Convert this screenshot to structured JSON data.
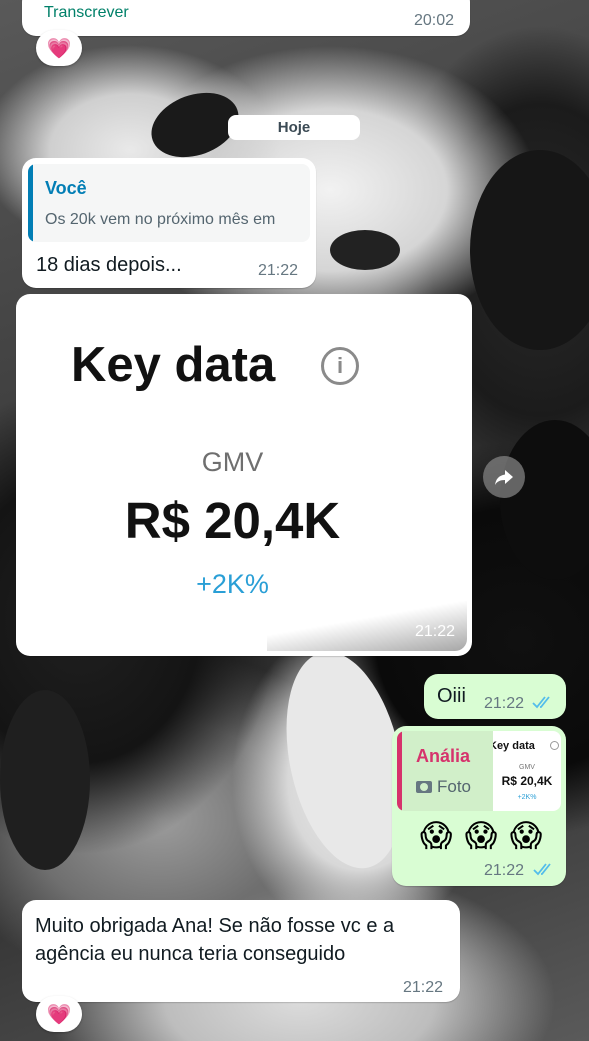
{
  "msg1": {
    "label": "Transcrever",
    "time": "20:02",
    "reaction": "💗"
  },
  "day_chip": "Hoje",
  "msg2": {
    "quote_author": "Você",
    "quote_text": "Os 20k vem no próximo mês em",
    "text": "18 dias depois...",
    "time": "21:22"
  },
  "msg3": {
    "card_title": "Key data",
    "metric_label": "GMV",
    "metric_value": "R$ 20,4K",
    "metric_change": "+2K%",
    "time": "21:22"
  },
  "msg4": {
    "text": "Oiii",
    "time": "21:22"
  },
  "msg5": {
    "quote_author": "Anália",
    "quote_type": "Foto",
    "thumb_title": "Key data",
    "thumb_label": "GMV",
    "thumb_value": "R$ 20,4K",
    "thumb_change": "+2K%",
    "emojis": "😱 😱 😱",
    "time": "21:22"
  },
  "msg6": {
    "text": "Muito obrigada Ana! Se não fosse vc e a agência eu nunca teria conseguido",
    "time": "21:22",
    "reaction": "💗"
  },
  "colors": {
    "incoming": "#ffffff",
    "outgoing": "#d9fdd3",
    "accent_teal": "#027eb5",
    "quote_pink": "#d6336c",
    "read_ticks": "#53bdeb",
    "change_blue": "#2a9fd6"
  }
}
